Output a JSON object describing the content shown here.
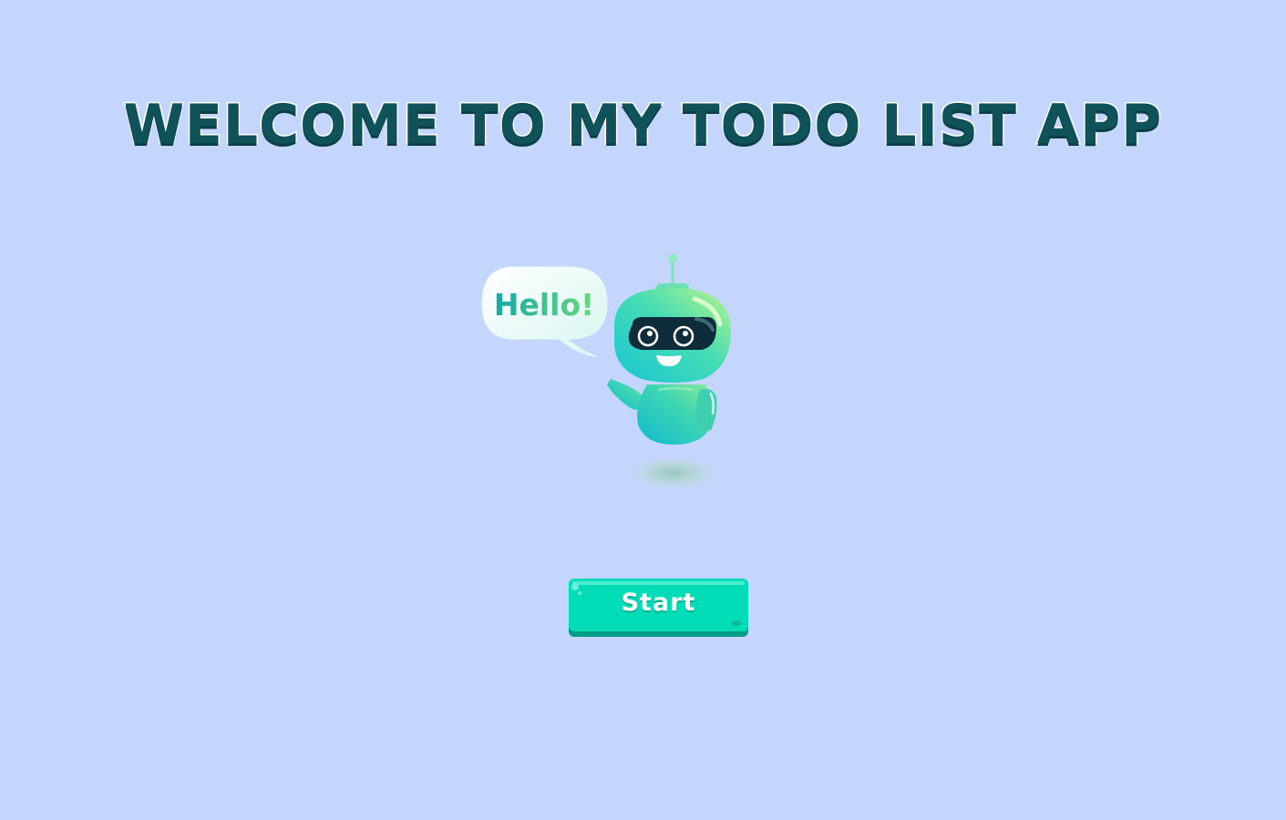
{
  "page": {
    "title": "WELCOME TO MY TODO LIST APP",
    "background_color": "#c5d6fe"
  },
  "mascot": {
    "icon": "robot-icon",
    "speech_bubble": {
      "text": "Hello!"
    }
  },
  "actions": {
    "start_label": "Start",
    "start_color": "#00dcb6"
  }
}
